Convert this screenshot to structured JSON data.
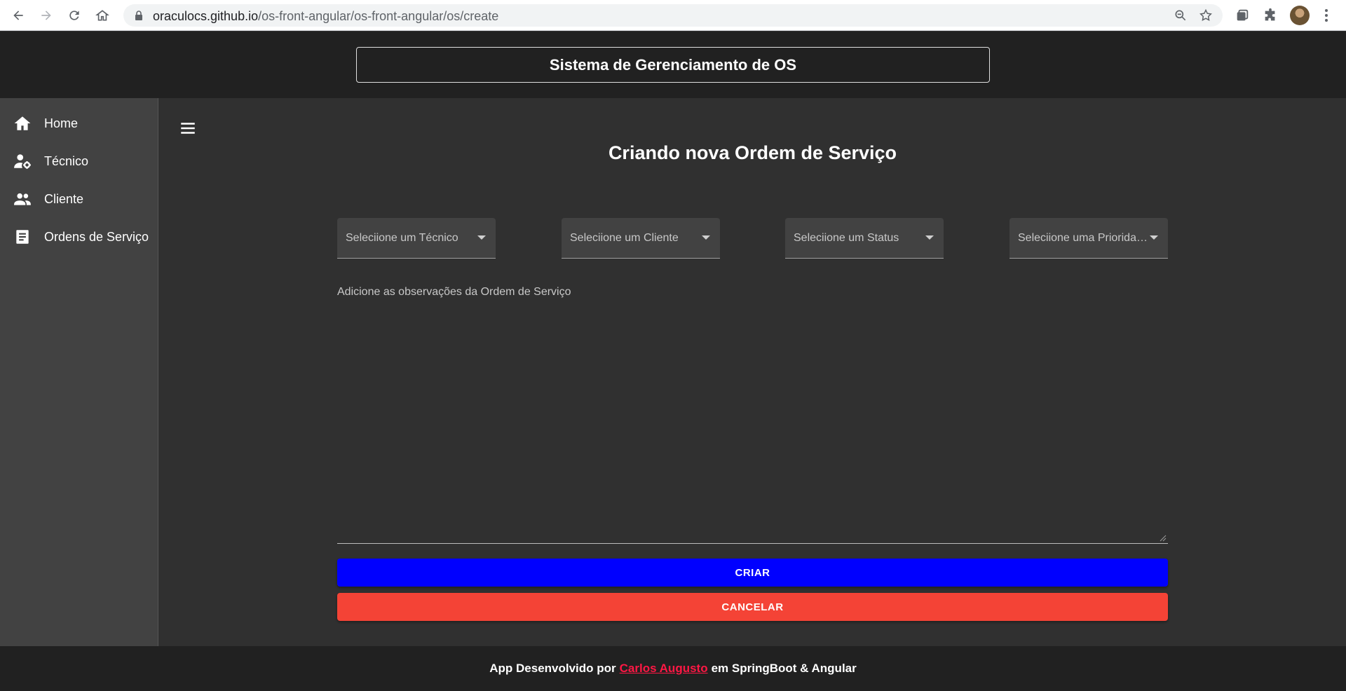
{
  "browser": {
    "url_host": "oraculocs.github.io",
    "url_path": "/os-front-angular/os-front-angular/os/create"
  },
  "header": {
    "title": "Sistema de Gerenciamento de OS"
  },
  "sidebar": {
    "items": [
      {
        "label": "Home",
        "icon": "home-icon"
      },
      {
        "label": "Técnico",
        "icon": "person-gear-icon"
      },
      {
        "label": "Cliente",
        "icon": "people-icon"
      },
      {
        "label": "Ordens de Serviço",
        "icon": "document-icon"
      }
    ]
  },
  "main": {
    "page_title": "Criando nova Ordem de Serviço",
    "selects": [
      {
        "placeholder": "Seleciione um Técnico"
      },
      {
        "placeholder": "Seleciione um Cliente"
      },
      {
        "placeholder": "Seleciione um Status"
      },
      {
        "placeholder": "Seleciione uma Prioridade"
      }
    ],
    "observations_label": "Adicione as observações da Ordem de Serviço",
    "create_label": "CRIAR",
    "cancel_label": "CANCELAR"
  },
  "footer": {
    "prefix": "App Desenvolvido por",
    "author": "Carlos Augusto",
    "suffix": "em SpringBoot & Angular"
  },
  "colors": {
    "create_button": "#0000ff",
    "cancel_button": "#f44336",
    "author_link": "#ff1744",
    "header_bg": "#212121",
    "sidebar_bg": "#424242",
    "main_bg": "#303030"
  }
}
